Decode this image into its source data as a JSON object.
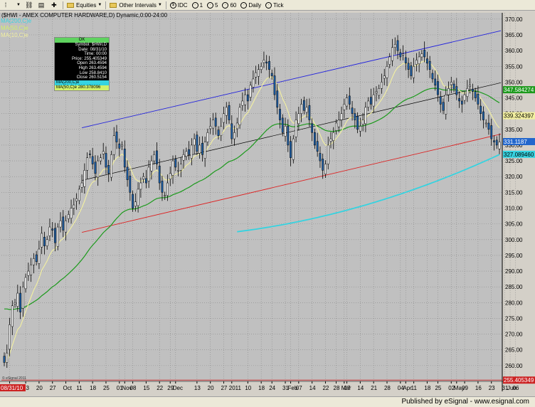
{
  "toolbar": {
    "items": [
      {
        "name": "equities-menu",
        "label": "Equities",
        "icon": "folder-icon"
      },
      {
        "name": "other-intervals-menu",
        "label": "Other Intervals",
        "icon": "folder-icon"
      },
      {
        "name": "idc-button",
        "label": "IDC",
        "icon": "dollar-icon"
      },
      {
        "name": "interval-1-button",
        "label": "1"
      },
      {
        "name": "interval-5-button",
        "label": "5"
      },
      {
        "name": "interval-60-button",
        "label": "60"
      },
      {
        "name": "daily-button",
        "label": "Daily"
      },
      {
        "name": "tick-button",
        "label": "Tick"
      }
    ]
  },
  "chart_title": "($HWI - AMEX COMPUTER HARDWARE,D) Dynamic,0:00-24:00",
  "legend": {
    "ma200": "MA(200,C)e",
    "ma50": "MA(50,C)e",
    "ma10": "MA(10,C)e"
  },
  "info_box": {
    "ok": "OK",
    "rows": [
      {
        "k": "Symbol:",
        "v": "$HWI,D"
      },
      {
        "k": "Date:",
        "v": "08/31/10"
      },
      {
        "k": "Time:",
        "v": "00:00"
      },
      {
        "k": "Price:",
        "v": "255.405349"
      },
      {
        "k": "Open",
        "v": "263.4594"
      },
      {
        "k": "High",
        "v": "263.4594"
      },
      {
        "k": "Low",
        "v": "258.8410"
      },
      {
        "k": "Close",
        "v": "260.5154"
      }
    ],
    "ma200_label": "MA(200,C)e",
    "ma50_label": "MA(50,C)e",
    "ma50_value": "280.378096"
  },
  "price_labels": {
    "ma50": "347.584274",
    "ma10": "339.324397",
    "last": "331.1187",
    "ma200": "327.089460",
    "cursor": "255.405349"
  },
  "cursor_date": "08/31/10",
  "watermark": "© eSignal 2011",
  "footer": "Published by eSignal - www.esignal.com",
  "colors": {
    "background": "#c0c0c0",
    "candle_up": "#ffffff",
    "candle_down": "#1a5ea8",
    "ma10": "#f3f0a0",
    "ma50": "#1c9a1c",
    "ma200": "#36d3e0",
    "channel_top": "#2222dd",
    "channel_bottom": "#dd2222",
    "trend_mid": "#000000",
    "last_price": "#2266cc"
  },
  "chart_data": {
    "type": "candlestick",
    "y_range": [
      255,
      372
    ],
    "y_ticks": [
      370,
      365,
      360,
      355,
      350,
      345,
      340,
      335,
      330,
      325,
      320,
      315,
      310,
      305,
      300,
      295,
      290,
      285,
      280,
      275,
      270,
      265,
      260
    ],
    "x_ticks": [
      {
        "label": "Sep",
        "bar": 2
      },
      {
        "label": "13",
        "bar": 8
      },
      {
        "label": "20",
        "bar": 13
      },
      {
        "label": "27",
        "bar": 18
      },
      {
        "label": "Oct",
        "bar": 23
      },
      {
        "label": "11",
        "bar": 28
      },
      {
        "label": "18",
        "bar": 33
      },
      {
        "label": "25",
        "bar": 38
      },
      {
        "label": "01",
        "bar": 43
      },
      {
        "label": "Nov",
        "bar": 45
      },
      {
        "label": "08",
        "bar": 48
      },
      {
        "label": "15",
        "bar": 53
      },
      {
        "label": "22",
        "bar": 58
      },
      {
        "label": "29",
        "bar": 62
      },
      {
        "label": "Dec",
        "bar": 64
      },
      {
        "label": "13",
        "bar": 72
      },
      {
        "label": "20",
        "bar": 77
      },
      {
        "label": "27",
        "bar": 82
      },
      {
        "label": "2011",
        "bar": 85
      },
      {
        "label": "10",
        "bar": 91
      },
      {
        "label": "18",
        "bar": 96
      },
      {
        "label": "24",
        "bar": 100
      },
      {
        "label": "31",
        "bar": 105
      },
      {
        "label": "Feb",
        "bar": 107
      },
      {
        "label": "07",
        "bar": 110
      },
      {
        "label": "14",
        "bar": 115
      },
      {
        "label": "22",
        "bar": 120
      },
      {
        "label": "28",
        "bar": 124
      },
      {
        "label": "07",
        "bar": 128
      },
      {
        "label": "Mar",
        "bar": 127
      },
      {
        "label": "14",
        "bar": 133
      },
      {
        "label": "21",
        "bar": 138
      },
      {
        "label": "28",
        "bar": 143
      },
      {
        "label": "04",
        "bar": 148
      },
      {
        "label": "Apr",
        "bar": 150
      },
      {
        "label": "11",
        "bar": 153
      },
      {
        "label": "18",
        "bar": 158
      },
      {
        "label": "25",
        "bar": 162
      },
      {
        "label": "02",
        "bar": 167
      },
      {
        "label": "May",
        "bar": 169
      },
      {
        "label": "09",
        "bar": 172
      },
      {
        "label": "16",
        "bar": 177
      },
      {
        "label": "23",
        "bar": 182
      },
      {
        "label": "31",
        "bar": 187
      },
      {
        "label": "Jun",
        "bar": 189
      },
      {
        "label": "06",
        "bar": 191
      }
    ],
    "closes": [
      261,
      264,
      273,
      279,
      280,
      283,
      277,
      285,
      288,
      290,
      292,
      294,
      293,
      297,
      302,
      298,
      300,
      304,
      303,
      299,
      304,
      306,
      303,
      306,
      308,
      310,
      311,
      313,
      316,
      318,
      322,
      326,
      327,
      324,
      321,
      325,
      326,
      328,
      323,
      321,
      327,
      333,
      331,
      329,
      330,
      323,
      319,
      315,
      310,
      312,
      316,
      318,
      320,
      318,
      323,
      325,
      327,
      324,
      318,
      315,
      314,
      318,
      321,
      325,
      323,
      322,
      324,
      327,
      328,
      327,
      330,
      332,
      328,
      330,
      327,
      331,
      334,
      336,
      338,
      336,
      333,
      336,
      340,
      342,
      338,
      332,
      334,
      337,
      342,
      344,
      346,
      344,
      349,
      351,
      353,
      354,
      355,
      357,
      356,
      354,
      352,
      346,
      342,
      338,
      334,
      336,
      330,
      326,
      332,
      338,
      340,
      343,
      341,
      342,
      338,
      334,
      330,
      328,
      325,
      322,
      324,
      330,
      332,
      334,
      337,
      338,
      340,
      343,
      345,
      343,
      340,
      338,
      335,
      336,
      338,
      342,
      344,
      343,
      346,
      347,
      348,
      350,
      352,
      355,
      358,
      361,
      362,
      360,
      358,
      359,
      356,
      354,
      352,
      355,
      357,
      358,
      359,
      358,
      356,
      354,
      351,
      349,
      346,
      343,
      341,
      346,
      348,
      350,
      348,
      346,
      344,
      343,
      346,
      348,
      349,
      347,
      345,
      343,
      340,
      338,
      337,
      335,
      332,
      331,
      330,
      331
    ],
    "ma10_last": 339.324397,
    "ma50_last": 347.584274,
    "ma200_last": 327.08946,
    "last_price": 331.1187
  }
}
